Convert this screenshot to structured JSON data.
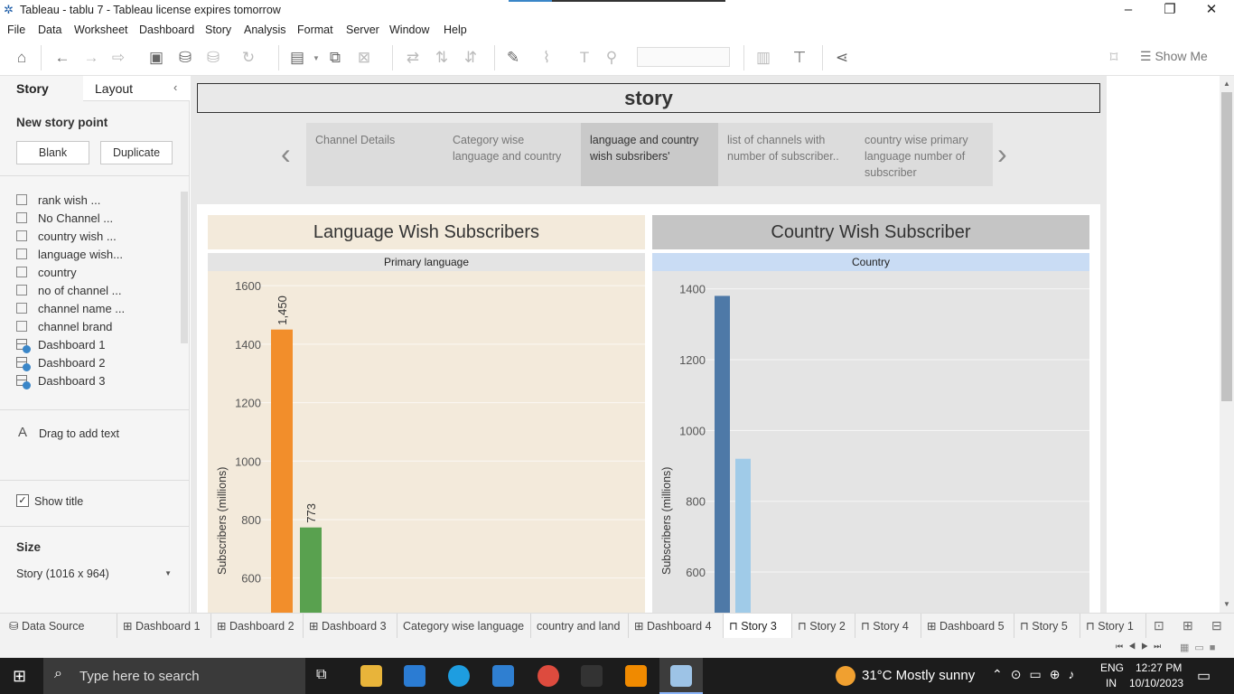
{
  "window": {
    "title": "Tableau - tablu 7 - Tableau license expires tomorrow"
  },
  "menu": [
    "File",
    "Data",
    "Worksheet",
    "Dashboard",
    "Story",
    "Analysis",
    "Format",
    "Server",
    "Window",
    "Help"
  ],
  "toolbar": {
    "show_me": "Show Me"
  },
  "sidebar": {
    "tab_story": "Story",
    "tab_layout": "Layout",
    "new_story_point": "New story point",
    "blank": "Blank",
    "duplicate": "Duplicate",
    "sheets": [
      {
        "label": "rank wish ...",
        "kind": "sheet"
      },
      {
        "label": "No Channel ...",
        "kind": "sheet"
      },
      {
        "label": "country wish ...",
        "kind": "sheet"
      },
      {
        "label": "language wish...",
        "kind": "sheet"
      },
      {
        "label": "country",
        "kind": "sheet"
      },
      {
        "label": "no of channel ...",
        "kind": "sheet"
      },
      {
        "label": "channel name ...",
        "kind": "sheet"
      },
      {
        "label": "channel brand",
        "kind": "sheet"
      },
      {
        "label": "Dashboard 1",
        "kind": "dashboard"
      },
      {
        "label": "Dashboard 2",
        "kind": "dashboard"
      },
      {
        "label": "Dashboard 3",
        "kind": "dashboard"
      }
    ],
    "drag_text": "Drag to add text",
    "show_title": "Show title",
    "size_heading": "Size",
    "size_value": "Story (1016 x 964)"
  },
  "story": {
    "title": "story",
    "points": [
      "Channel Details",
      "Category wise language and country",
      "language and country wish subsribers'",
      "list of channels with number of subscriber..",
      "country wise primary language number of subscriber"
    ],
    "active_point": 2
  },
  "chart_data": [
    {
      "type": "bar",
      "title": "Language Wish Subscribers",
      "header": "Primary language",
      "ylabel": "Subscribers (millions)",
      "yticks": [
        600,
        800,
        1000,
        1200,
        1400,
        1600
      ],
      "ylim": [
        500,
        1650
      ],
      "values": [
        1450,
        773
      ],
      "data_labels": [
        "1,450",
        "773"
      ],
      "colors": [
        "#f28e2b",
        "#59a14f"
      ],
      "background": "#f3eadb"
    },
    {
      "type": "bar",
      "title": "Country Wish Subscriber",
      "header": "Country",
      "ylabel": "Subscribers (millions)",
      "yticks": [
        600,
        800,
        1000,
        1200,
        1400
      ],
      "ylim": [
        470,
        1450
      ],
      "values": [
        1380,
        920
      ],
      "colors": [
        "#4e79a7",
        "#a0cbe8"
      ],
      "background": "#e4e4e4"
    }
  ],
  "tabs": [
    {
      "label": "Data Source",
      "icon": "database-icon"
    },
    {
      "label": "Dashboard 1",
      "icon": "dashboard-icon"
    },
    {
      "label": "Dashboard 2",
      "icon": "dashboard-icon"
    },
    {
      "label": "Dashboard 3",
      "icon": "dashboard-icon"
    },
    {
      "label": "Category wise language",
      "icon": ""
    },
    {
      "label": "country and land",
      "icon": ""
    },
    {
      "label": "Dashboard 4",
      "icon": "dashboard-icon"
    },
    {
      "label": "Story 3",
      "icon": "story-icon"
    },
    {
      "label": "Story 2",
      "icon": "story-icon"
    },
    {
      "label": "Story 4",
      "icon": "story-icon"
    },
    {
      "label": "Dashboard 5",
      "icon": "dashboard-icon"
    },
    {
      "label": "Story 5",
      "icon": "story-icon"
    },
    {
      "label": "Story 1",
      "icon": "story-icon"
    }
  ],
  "active_tab": 7,
  "taskbar": {
    "search_placeholder": "Type here to search",
    "weather": "31°C  Mostly sunny",
    "lang": "ENG",
    "region": "IN",
    "time": "12:27 PM",
    "date": "10/10/2023"
  }
}
